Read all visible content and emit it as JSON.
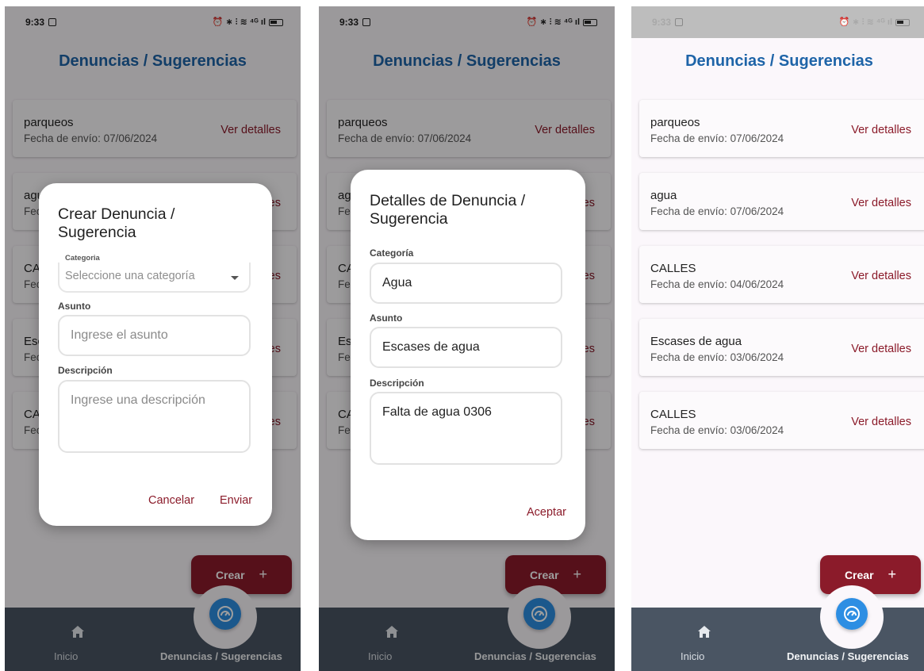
{
  "status_bar": {
    "time": "9:33",
    "icons": "⏰ ∗ ⫶ ≋ ⁴ᴳ ıl"
  },
  "app": {
    "title": "Denuncias / Sugerencias"
  },
  "list": {
    "link_label": "Ver detalles",
    "items": [
      {
        "title": "parqueos",
        "date": "Fecha de envío: 07/06/2024"
      },
      {
        "title": "agua",
        "date": "Fecha de envío: 07/06/2024"
      },
      {
        "title": "CALLES",
        "date": "Fecha de envío: 04/06/2024"
      },
      {
        "title": "Escases de agua",
        "date": "Fecha de envío: 03/06/2024"
      },
      {
        "title": "CALLES",
        "date": "Fecha de envío: 03/06/2024"
      }
    ]
  },
  "fab": {
    "label": "Crear",
    "icon": "+"
  },
  "bottom_nav": {
    "home_label": "Inicio",
    "active_label": "Denuncias / Sugerencias",
    "icons": {
      "home": "home-icon",
      "center": "gauge-icon"
    }
  },
  "create_dialog": {
    "title": "Crear Denuncia / Sugerencia",
    "category_label": "Categoria",
    "category_placeholder": "Seleccione una categoría",
    "subject_label": "Asunto",
    "subject_placeholder": "Ingrese el asunto",
    "description_label": "Descripción",
    "description_placeholder": "Ingrese una descripción",
    "cancel_label": "Cancelar",
    "send_label": "Enviar"
  },
  "details_dialog": {
    "title": "Detalles de Denuncia / Sugerencia",
    "category_label": "Categoría",
    "category_value": "Agua",
    "subject_label": "Asunto",
    "subject_value": "Escases de agua",
    "description_label": "Descripción",
    "description_value": "Falta de agua 0306",
    "accept_label": "Aceptar"
  },
  "colors": {
    "title_blue": "#1e64a8",
    "accent_red": "#8b1b2a",
    "nav_bg": "#4a5563",
    "fab_blue": "#2d8ee3"
  }
}
